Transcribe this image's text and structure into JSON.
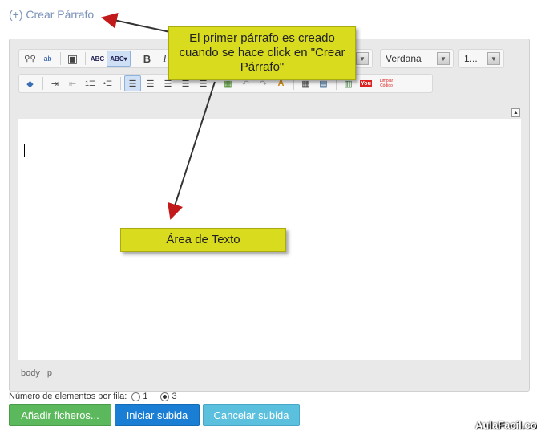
{
  "header": {
    "crear_link": "(+) Crear Párrafo"
  },
  "toolbar": {
    "row1": [
      {
        "icon": "binoculars-icon",
        "glyph": "🔍"
      },
      {
        "icon": "replace-icon",
        "glyph": "ab"
      },
      {
        "icon": "fullscreen-icon",
        "glyph": "▣"
      },
      {
        "icon": "spellcheck-icon",
        "glyph": "ABC"
      },
      {
        "icon": "spellcheck-dropdown-icon",
        "glyph": "ABC▾"
      },
      {
        "icon": "bold-icon",
        "glyph": "B"
      },
      {
        "icon": "italic-icon",
        "glyph": "I"
      }
    ],
    "row2": [
      {
        "icon": "eraser-icon",
        "glyph": "◇"
      },
      {
        "icon": "indent-icon",
        "glyph": "⇥"
      },
      {
        "icon": "outdent-icon",
        "glyph": "⇤"
      },
      {
        "icon": "ordered-list-icon",
        "glyph": "1≡"
      },
      {
        "icon": "unordered-list-icon",
        "glyph": "•≡"
      },
      {
        "icon": "align-left-icon",
        "glyph": "≡"
      },
      {
        "icon": "align-center-icon",
        "glyph": "≡"
      },
      {
        "icon": "align-right-icon",
        "glyph": "≡"
      },
      {
        "icon": "justify-icon",
        "glyph": "≡"
      },
      {
        "icon": "justify-full-icon",
        "glyph": "≡"
      },
      {
        "icon": "image-icon",
        "glyph": "▦"
      },
      {
        "icon": "undo-icon",
        "glyph": "↶"
      },
      {
        "icon": "redo-icon",
        "glyph": "↷"
      },
      {
        "icon": "color-icon",
        "glyph": "A"
      },
      {
        "icon": "table-icon",
        "glyph": "▦"
      },
      {
        "icon": "media-icon",
        "glyph": "▤"
      },
      {
        "icon": "attach-icon",
        "glyph": "▥"
      },
      {
        "icon": "youtube-icon",
        "glyph": "You"
      },
      {
        "icon": "clean-code-icon",
        "glyph": "Limpiar Código"
      }
    ],
    "font_select": "Verdana",
    "size_select": "1..."
  },
  "status_bar": {
    "items": [
      "body",
      "p"
    ]
  },
  "callouts": {
    "first": "El primer párrafo es creado cuando se hace click en \"Crear Párrafo\"",
    "text_area": "Área de Texto"
  },
  "per_row": {
    "label": "Número de elementos por fila:",
    "options": [
      {
        "value": "1",
        "checked": false
      },
      {
        "value": "3",
        "checked": true
      }
    ]
  },
  "buttons": {
    "add": "Añadir ficheros...",
    "start": "Iniciar subida",
    "cancel": "Cancelar subida"
  },
  "watermark": "AulaFacil.com"
}
